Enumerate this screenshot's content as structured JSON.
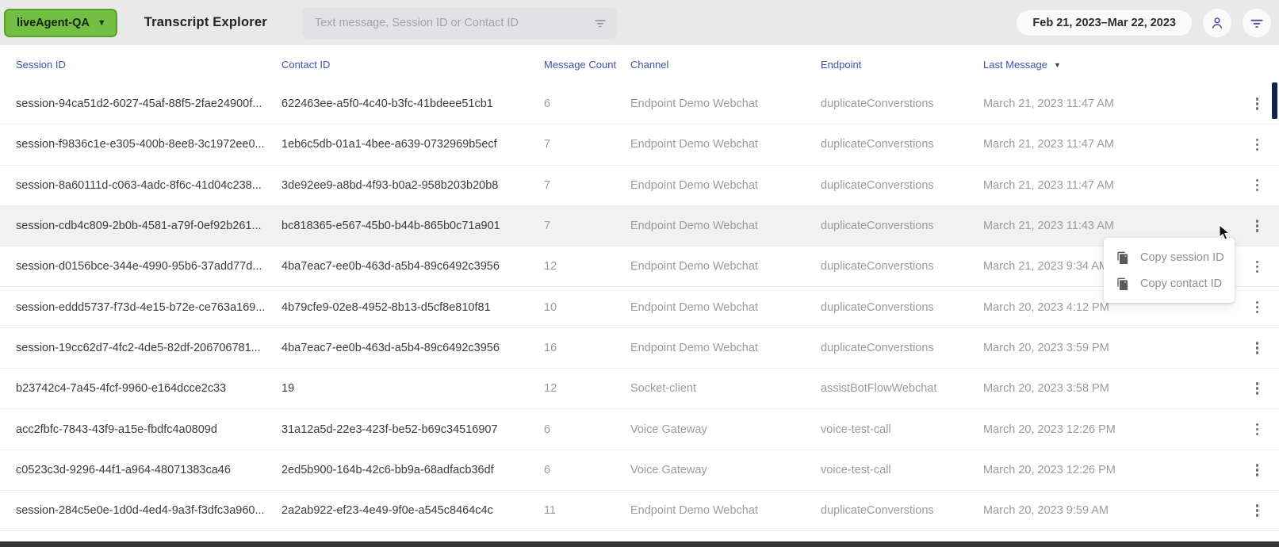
{
  "header": {
    "app_button": {
      "label": "liveAgent-QA"
    },
    "title": "Transcript Explorer",
    "search": {
      "placeholder": "Text message, Session ID or Contact ID",
      "value": ""
    },
    "date_range": "Feb 21, 2023–Mar 22, 2023",
    "icons": [
      "filter-icon",
      "user-icon",
      "filter-icon"
    ]
  },
  "colors": {
    "brand_green": "#72bf44",
    "header_blue": "#4150b0",
    "topbar_gray": "#e9e9e9",
    "muted_text": "#9b9b9b",
    "scrollbar_navy": "#15224b"
  },
  "table": {
    "columns": [
      "Session ID",
      "Contact ID",
      "Message Count",
      "Channel",
      "Endpoint",
      "Last Message"
    ],
    "sorted_column": "Last Message",
    "rows": [
      {
        "session_id": "session-94ca51d2-6027-45af-88f5-2fae24900f...",
        "contact_id": "622463ee-a5f0-4c40-b3fc-41bdeee51cb1",
        "message_count": "6",
        "channel": "Endpoint Demo Webchat",
        "endpoint": "duplicateConverstions",
        "last_message": "March 21, 2023 11:47 AM"
      },
      {
        "session_id": "session-f9836c1e-e305-400b-8ee8-3c1972ee0...",
        "contact_id": "1eb6c5db-01a1-4bee-a639-0732969b5ecf",
        "message_count": "7",
        "channel": "Endpoint Demo Webchat",
        "endpoint": "duplicateConverstions",
        "last_message": "March 21, 2023 11:47 AM"
      },
      {
        "session_id": "session-8a60111d-c063-4adc-8f6c-41d04c238...",
        "contact_id": "3de92ee9-a8bd-4f93-b0a2-958b203b20b8",
        "message_count": "7",
        "channel": "Endpoint Demo Webchat",
        "endpoint": "duplicateConverstions",
        "last_message": "March 21, 2023 11:47 AM"
      },
      {
        "session_id": "session-cdb4c809-2b0b-4581-a79f-0ef92b261...",
        "contact_id": "bc818365-e567-45b0-b44b-865b0c71a901",
        "message_count": "7",
        "channel": "Endpoint Demo Webchat",
        "endpoint": "duplicateConverstions",
        "last_message": "March 21, 2023 11:43 AM",
        "highlighted": true
      },
      {
        "session_id": "session-d0156bce-344e-4990-95b6-37add77d...",
        "contact_id": "4ba7eac7-ee0b-463d-a5b4-89c6492c3956",
        "message_count": "12",
        "channel": "Endpoint Demo Webchat",
        "endpoint": "duplicateConverstions",
        "last_message": "March 21, 2023 9:34 AM"
      },
      {
        "session_id": "session-eddd5737-f73d-4e15-b72e-ce763a169...",
        "contact_id": "4b79cfe9-02e8-4952-8b13-d5cf8e810f81",
        "message_count": "10",
        "channel": "Endpoint Demo Webchat",
        "endpoint": "duplicateConverstions",
        "last_message": "March 20, 2023 4:12 PM"
      },
      {
        "session_id": "session-19cc62d7-4fc2-4de5-82df-206706781...",
        "contact_id": "4ba7eac7-ee0b-463d-a5b4-89c6492c3956",
        "message_count": "16",
        "channel": "Endpoint Demo Webchat",
        "endpoint": "duplicateConverstions",
        "last_message": "March 20, 2023 3:59 PM"
      },
      {
        "session_id": "b23742c4-7a45-4fcf-9960-e164dcce2c33",
        "contact_id": "19",
        "message_count": "12",
        "channel": "Socket-client",
        "endpoint": "assistBotFlowWebchat",
        "last_message": "March 20, 2023 3:58 PM"
      },
      {
        "session_id": "acc2fbfc-7843-43f9-a15e-fbdfc4a0809d",
        "contact_id": "31a12a5d-22e3-423f-be52-b69c34516907",
        "message_count": "6",
        "channel": "Voice Gateway",
        "endpoint": "voice-test-call",
        "last_message": "March 20, 2023 12:26 PM"
      },
      {
        "session_id": "c0523c3d-9296-44f1-a964-48071383ca46",
        "contact_id": "2ed5b900-164b-42c6-bb9a-68adfacb36df",
        "message_count": "6",
        "channel": "Voice Gateway",
        "endpoint": "voice-test-call",
        "last_message": "March 20, 2023 12:26 PM"
      },
      {
        "session_id": "session-284c5e0e-1d0d-4ed4-9a3f-f3dfc3a960...",
        "contact_id": "2a2ab922-ef23-4e49-9f0e-a545c8464c4c",
        "message_count": "11",
        "channel": "Endpoint Demo Webchat",
        "endpoint": "duplicateConverstions",
        "last_message": "March 20, 2023 9:59 AM"
      }
    ]
  },
  "context_menu": {
    "items": [
      {
        "label": "Copy session ID",
        "icon": "copy-icon"
      },
      {
        "label": "Copy contact ID",
        "icon": "copy-icon"
      }
    ]
  }
}
